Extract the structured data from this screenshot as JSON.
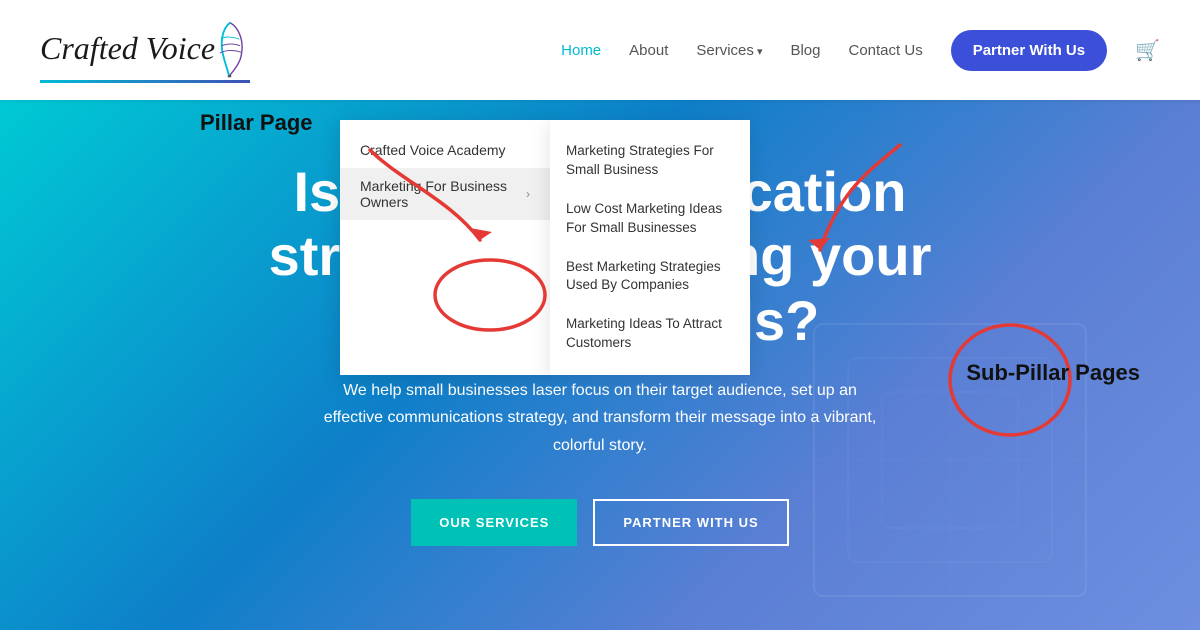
{
  "header": {
    "logo_text": "Crafted Voice",
    "nav_items": [
      {
        "label": "Home",
        "active": true,
        "has_arrow": false
      },
      {
        "label": "About",
        "active": false,
        "has_arrow": false
      },
      {
        "label": "Services",
        "active": false,
        "has_arrow": true
      },
      {
        "label": "Blog",
        "active": false,
        "has_arrow": false
      },
      {
        "label": "Contact Us",
        "active": false,
        "has_arrow": false
      }
    ],
    "cta_button": "Partner With Us",
    "cart_icon": "🛒"
  },
  "hero": {
    "title": "Is your communication strategy supporting your business goals?",
    "subtitle": "We help small businesses laser focus on their target audience, set up an effective communications strategy, and transform their message into a vibrant, colorful story.",
    "btn_services": "OUR SERVICES",
    "btn_partner": "PARTNER WITH US"
  },
  "dropdown": {
    "pillar_label": "Pillar Page",
    "subpillar_label": "Sub-Pillar Pages",
    "left_items": [
      {
        "label": "Crafted Voice Academy",
        "has_arrow": false
      },
      {
        "label": "Marketing For Business Owners",
        "has_arrow": true,
        "active": true
      }
    ],
    "right_items": [
      "Marketing Strategies For Small Business",
      "Low Cost Marketing Ideas For Small Businesses",
      "Best Marketing Strategies Used By Companies",
      "Marketing Ideas To Attract Customers"
    ]
  }
}
